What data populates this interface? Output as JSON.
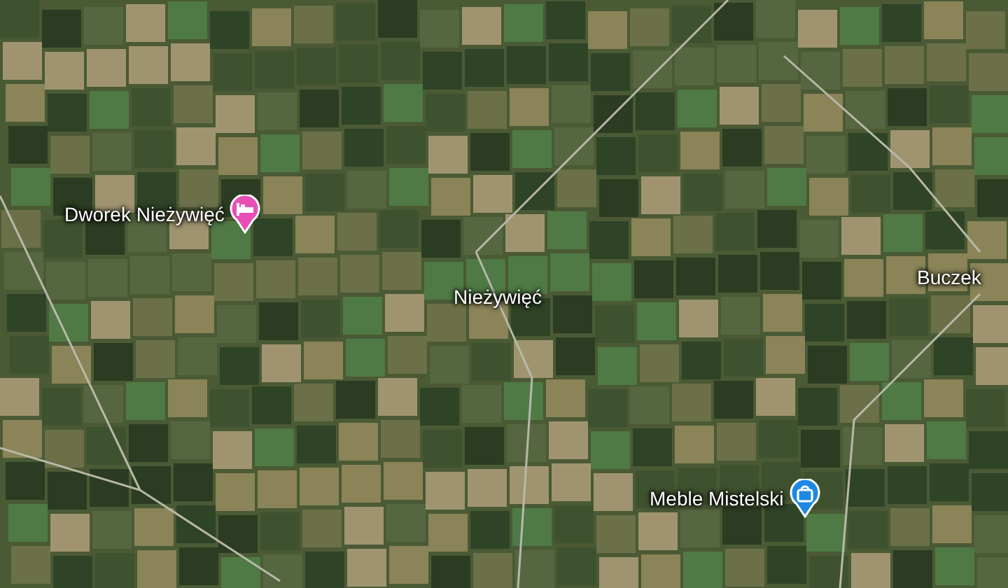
{
  "map": {
    "places": [
      {
        "name": "Dworek Nieżywięć",
        "kind": "hotel",
        "color": "#e84fb5"
      },
      {
        "name": "Nieżywięć",
        "kind": "locality"
      },
      {
        "name": "Buczek",
        "kind": "locality"
      },
      {
        "name": "Meble Mistelski",
        "kind": "shop",
        "color": "#1e88e5"
      }
    ]
  }
}
